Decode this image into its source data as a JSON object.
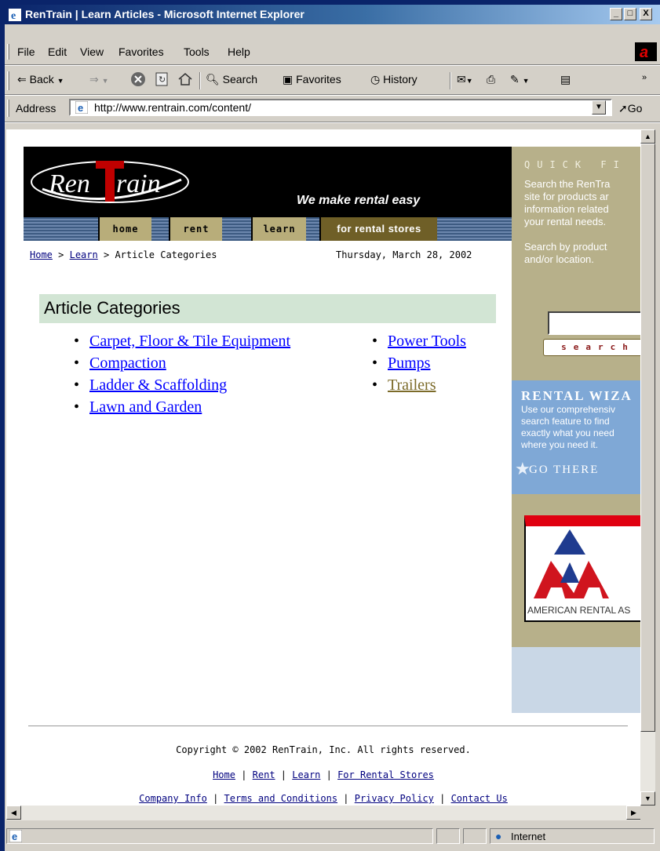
{
  "window": {
    "title": "RenTrain | Learn Articles - Microsoft Internet Explorer",
    "controls": [
      "_",
      "□",
      "X"
    ]
  },
  "menu": [
    "File",
    "Edit",
    "View",
    "Favorites",
    "Tools",
    "Help"
  ],
  "toolbar": {
    "back": "Back",
    "search": "Search",
    "favorites": "Favorites",
    "history": "History"
  },
  "address": {
    "label": "Address",
    "url": "http://www.rentrain.com/content/",
    "go": "Go"
  },
  "page": {
    "logo_text": "RenTrain",
    "tagline": "We make rental easy",
    "nav": [
      "home",
      "rent",
      "learn",
      "for rental stores"
    ],
    "breadcrumb": {
      "home": "Home",
      "learn": "Learn",
      "current": "Article Categories",
      "sep": ">"
    },
    "date": "Thursday, March 28, 2002",
    "categories_title": "Article Categories",
    "categories_left": [
      "Carpet, Floor & Tile Equipment",
      "Compaction",
      "Ladder & Scaffolding",
      "Lawn and Garden"
    ],
    "categories_right": [
      "Power Tools",
      "Pumps",
      "Trailers"
    ]
  },
  "sidebar": {
    "quick_find_title": "QUICK FI",
    "quick_find_text": [
      "Search the RenTra",
      "site for products ar",
      "information related",
      "your rental needs."
    ],
    "quick_find_text2": [
      "Search by product",
      "and/or location."
    ],
    "search_button": "search",
    "wizard_title": "RENTAL WIZA",
    "wizard_text": [
      "Use our comprehensiv",
      "search feature to find",
      "exactly what you need",
      "where you need it."
    ],
    "wizard_go": "GO THERE",
    "ara_text": "AMERICAN RENTAL AS"
  },
  "footer": {
    "copyright": "Copyright © 2002 RenTrain, Inc. All rights reserved.",
    "links1": [
      "Home",
      "Rent",
      "Learn",
      "For Rental Stores"
    ],
    "links2": [
      "Company Info",
      "Terms and Conditions",
      "Privacy Policy",
      "Contact Us"
    ]
  },
  "status": {
    "zone": "Internet"
  },
  "colors": {
    "title_bar": "#0a246a",
    "chrome": "#d4d0c8",
    "nav_tan": "#b8ad7a",
    "sidebar": "#b7b08a",
    "category_header": "#d2e5d4",
    "link": "#0000ff"
  }
}
